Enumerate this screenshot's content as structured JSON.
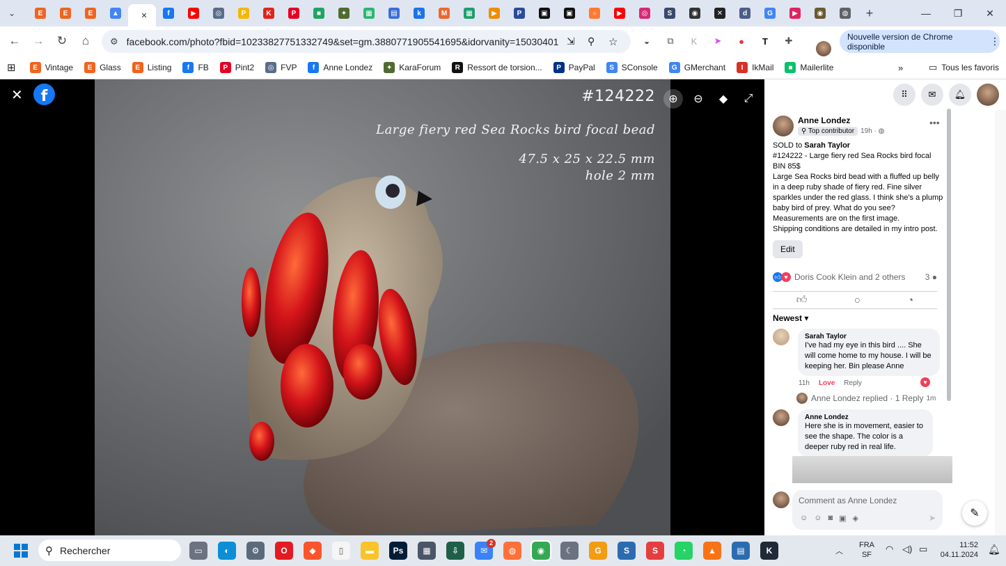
{
  "browser": {
    "tabs": [
      {
        "icon": "etsy-icon",
        "color": "#f1641e",
        "glyph": "E"
      },
      {
        "icon": "etsy-icon",
        "color": "#f1641e",
        "glyph": "E"
      },
      {
        "icon": "etsy-icon",
        "color": "#f1641e",
        "glyph": "E"
      },
      {
        "icon": "drive-icon",
        "color": "#4285f4",
        "glyph": "▲"
      },
      {
        "icon": "facebook-icon",
        "color": "#1877f2",
        "glyph": "f",
        "active": true
      },
      {
        "icon": "facebook-icon",
        "color": "#1877f2",
        "glyph": "f"
      },
      {
        "icon": "youtube-icon",
        "color": "#ff0000",
        "glyph": "▶"
      },
      {
        "icon": "fvp-icon",
        "color": "#5a6c8a",
        "glyph": "◎"
      },
      {
        "icon": "paypal-yellow-icon",
        "color": "#f5b800",
        "glyph": "P"
      },
      {
        "icon": "k-red-icon",
        "color": "#e2231a",
        "glyph": "K"
      },
      {
        "icon": "pinterest-icon",
        "color": "#e60023",
        "glyph": "P"
      },
      {
        "icon": "chat-green-icon",
        "color": "#1fa463",
        "glyph": "■"
      },
      {
        "icon": "karaforum-icon",
        "color": "#4f6b2f",
        "glyph": "✦"
      },
      {
        "icon": "grid-green-icon",
        "color": "#2bb673",
        "glyph": "▦"
      },
      {
        "icon": "printer-icon",
        "color": "#3a6fd8",
        "glyph": "▤"
      },
      {
        "icon": "k-blue-icon",
        "color": "#1a73e8",
        "glyph": "k"
      },
      {
        "icon": "magento-icon",
        "color": "#ee672f",
        "glyph": "M"
      },
      {
        "icon": "grid-teal-icon",
        "color": "#1e9e6e",
        "glyph": "▦"
      },
      {
        "icon": "play-orange-icon",
        "color": "#f08c00",
        "glyph": "▶"
      },
      {
        "icon": "p-circle-icon",
        "color": "#2a4a9a",
        "glyph": "P"
      },
      {
        "icon": "black-box-icon",
        "color": "#111111",
        "glyph": "▣"
      },
      {
        "icon": "black-box-icon",
        "color": "#111111",
        "glyph": "▣"
      },
      {
        "icon": "ring-orange-icon",
        "color": "#ff7a30",
        "glyph": "○"
      },
      {
        "icon": "youtube-icon",
        "color": "#ff0000",
        "glyph": "▶"
      },
      {
        "icon": "instagram-icon",
        "color": "#d62976",
        "glyph": "◎"
      },
      {
        "icon": "s-circle-icon",
        "color": "#3b4a6b",
        "glyph": "S"
      },
      {
        "icon": "compass-icon",
        "color": "#333333",
        "glyph": "◉"
      },
      {
        "icon": "bluesky-icon",
        "color": "#222222",
        "glyph": "✕"
      },
      {
        "icon": "d-circle-icon",
        "color": "#4b5d8a",
        "glyph": "d"
      },
      {
        "icon": "google-icon",
        "color": "#4285f4",
        "glyph": "G"
      },
      {
        "icon": "youtube-circle-icon",
        "color": "#e0245e",
        "glyph": "▶"
      },
      {
        "icon": "brown-circle-icon",
        "color": "#6b5a2e",
        "glyph": "◉"
      },
      {
        "icon": "globe-icon",
        "color": "#5f6368",
        "glyph": "◍"
      }
    ],
    "url": "facebook.com/photo?fbid=10233827751332749&set=gm.3880771905541695&idorvanity=15030401666...",
    "update_label": "Nouvelle version de Chrome disponible",
    "bookmarks": [
      {
        "label": "Vintage",
        "icon": "etsy-icon",
        "color": "#f1641e",
        "glyph": "E"
      },
      {
        "label": "Glass",
        "icon": "etsy-icon",
        "color": "#f1641e",
        "glyph": "E"
      },
      {
        "label": "Listing",
        "icon": "etsy-icon",
        "color": "#f1641e",
        "glyph": "E"
      },
      {
        "label": "FB",
        "icon": "facebook-icon",
        "color": "#1877f2",
        "glyph": "f"
      },
      {
        "label": "Pint2",
        "icon": "pinterest-icon",
        "color": "#e60023",
        "glyph": "P"
      },
      {
        "label": "FVP",
        "icon": "fvp-icon",
        "color": "#5a6c8a",
        "glyph": "◎"
      },
      {
        "label": "Anne Londez",
        "icon": "facebook-icon",
        "color": "#1877f2",
        "glyph": "f"
      },
      {
        "label": "KaraForum",
        "icon": "karaforum-icon",
        "color": "#4f6b2f",
        "glyph": "✦"
      },
      {
        "label": "Ressort de torsion...",
        "icon": "ressort-icon",
        "color": "#111111",
        "glyph": "R"
      },
      {
        "label": "PayPal",
        "icon": "paypal-icon",
        "color": "#003087",
        "glyph": "P"
      },
      {
        "label": "SConsole",
        "icon": "sconsole-icon",
        "color": "#4285f4",
        "glyph": "S"
      },
      {
        "label": "GMerchant",
        "icon": "gmerchant-icon",
        "color": "#4285f4",
        "glyph": "G"
      },
      {
        "label": "IkMail",
        "icon": "ikmail-icon",
        "color": "#d93025",
        "glyph": "I"
      },
      {
        "label": "Mailerlite",
        "icon": "mailerlite-icon",
        "color": "#09c269",
        "glyph": "■"
      }
    ],
    "all_bookmarks_label": "Tous les favoris"
  },
  "photo": {
    "id_text": "#124222",
    "title_text": "Large fiery red Sea Rocks bird focal bead",
    "dims_text": "47.5 x 25 x 22.5 mm",
    "hole_text": "hole 2 mm"
  },
  "post": {
    "author": "Anne Londez",
    "badge": "Top contributor",
    "time": "19h",
    "sold_prefix": "SOLD to",
    "sold_to": "Sarah Taylor",
    "body_lines": [
      "#124222 - Large fiery red Sea Rocks bird focal",
      "BIN 85$",
      "Large Sea Rocks bird bead with a fluffed up belly in a deep ruby shade of fiery red. Fine silver sparkles under the red glass. I think she's a plump baby bird of prey. What do you see?",
      "Measurements are on the first image.",
      "Shipping conditions are detailed in my intro post."
    ],
    "edit_label": "Edit",
    "reactions_text": "Doris Cook Klein and 2 others",
    "comment_count": "3",
    "sort_label": "Newest"
  },
  "comments": [
    {
      "name": "Sarah Taylor",
      "text": "I've had my eye in this bird .... She will come home to my house. I will be keeping her. Bin please Anne",
      "time": "11h",
      "love": "Love",
      "reply": "Reply"
    },
    {
      "name": "Anne Londez",
      "text": "Here she is in movement, easier to see the shape. The color is a deeper ruby red in real life."
    }
  ],
  "reply_summary": {
    "text": "Anne Londez replied · 1 Reply",
    "time": "1m"
  },
  "composer_placeholder": "Comment as Anne Londez",
  "taskbar": {
    "search_placeholder": "Rechercher",
    "lang_line1": "FRA",
    "lang_line2": "SF",
    "time": "11:52",
    "date": "04.11.2024",
    "badge_count": "2"
  }
}
